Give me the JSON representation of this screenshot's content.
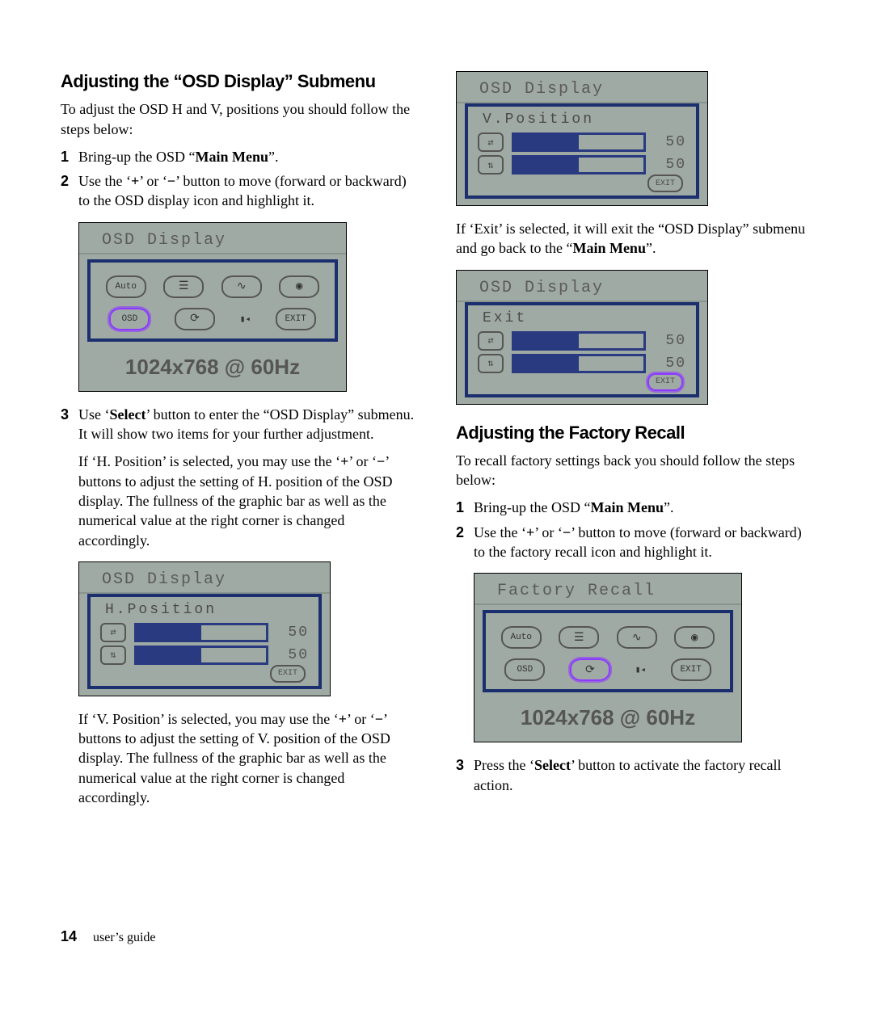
{
  "left": {
    "heading": "Adjusting the “OSD Display” Submenu",
    "intro": "To adjust the OSD H and V, positions you should follow the steps below:",
    "step1_pre": "Bring-up the OSD “",
    "step1_bold": "Main Menu",
    "step1_post": "”.",
    "step2_a": "Use the ‘",
    "step2_plus": "+",
    "step2_b": "’ or ‘",
    "step2_minus": "−",
    "step2_c": "’ button to move (forward or backward) to the OSD display icon and highlight it.",
    "step3_a": "Use ‘",
    "step3_bold": "Select",
    "step3_b": "’ button to enter the “OSD Display” submenu. It will show two items for your further adjustment.",
    "hpos_para_a": "If ‘H. Position’ is selected, you may use the ‘",
    "hpos_plus": "+",
    "hpos_para_b": "’ or ‘",
    "hpos_minus": "−",
    "hpos_para_c": "’ buttons to adjust the setting of H. position of the OSD display. The fullness of the graphic bar as well as the numerical value at the right corner is changed accordingly.",
    "vpos_para_a": "If ‘V. Position’ is selected, you may use the ‘",
    "vpos_plus": "+",
    "vpos_para_b": "’ or ‘",
    "vpos_minus": "−",
    "vpos_para_c": "’ buttons to adjust the setting of V. position of the OSD display. The fullness of the graphic bar as well as the numerical value at the right corner is changed accordingly."
  },
  "right": {
    "exit_para_a": "If ‘Exit’ is selected, it will exit the “OSD Display” submenu and go back to the “",
    "exit_bold": "Main Menu",
    "exit_para_b": "”.",
    "heading2": "Adjusting the Factory Recall",
    "intro2": "To recall factory settings back you should follow the steps below:",
    "r_step1_pre": "Bring-up the OSD “",
    "r_step1_bold": "Main Menu",
    "r_step1_post": "”.",
    "r_step2_a": "Use the ‘",
    "r_step2_plus": "+",
    "r_step2_b": "’ or ‘",
    "r_step2_minus": "−",
    "r_step2_c": "’ button to move (forward or backward) to the factory recall icon and highlight it.",
    "r_step3_a": "Press the ‘",
    "r_step3_bold": "Select",
    "r_step3_b": "’ button to activate the factory recall action."
  },
  "osd": {
    "display_title": "OSD Display",
    "factory_title": "Factory Recall",
    "resolution": "1024x768 @ 60Hz",
    "hpos_label": "H.Position",
    "vpos_label": "V.Position",
    "exit_label": "Exit",
    "icons": {
      "auto": "Auto",
      "osd": "OSD",
      "exit": "EXIT"
    },
    "value50": "50",
    "h_arrow": "⇄",
    "v_arrow": "⇅"
  },
  "footer": {
    "page_number": "14",
    "label": "user’s guide"
  }
}
